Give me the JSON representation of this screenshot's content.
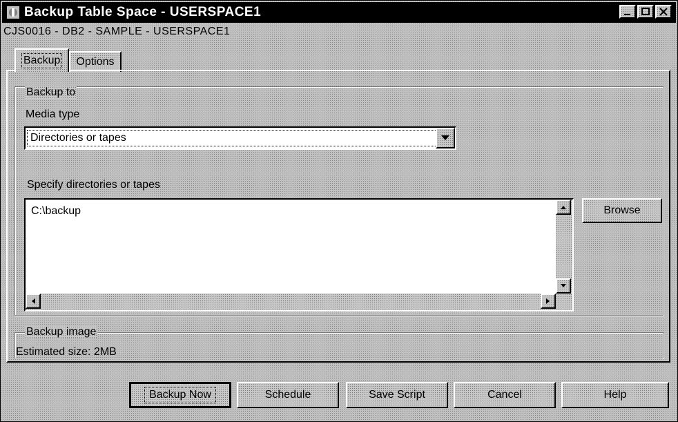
{
  "window": {
    "title": "Backup Table Space - USERSPACE1",
    "subtitle": "CJS0016 - DB2 - SAMPLE - USERSPACE1"
  },
  "title_controls": {
    "minimize_icon": "minimize-icon",
    "maximize_icon": "maximize-icon",
    "close_icon": "close-icon"
  },
  "tabs": [
    {
      "label": "Backup",
      "active": true
    },
    {
      "label": "Options",
      "active": false
    }
  ],
  "backup_to": {
    "group_title": "Backup to",
    "media_type_label": "Media type",
    "media_type_value": "Directories or tapes",
    "specify_label": "Specify directories or tapes",
    "list_items": [
      "C:\\backup"
    ],
    "browse_label": "Browse"
  },
  "backup_image": {
    "group_title": "Backup image",
    "estimated_size": "Estimated size: 2MB"
  },
  "buttons": {
    "backup_now": "Backup Now",
    "schedule": "Schedule",
    "save_script": "Save Script",
    "cancel": "Cancel",
    "help": "Help"
  }
}
